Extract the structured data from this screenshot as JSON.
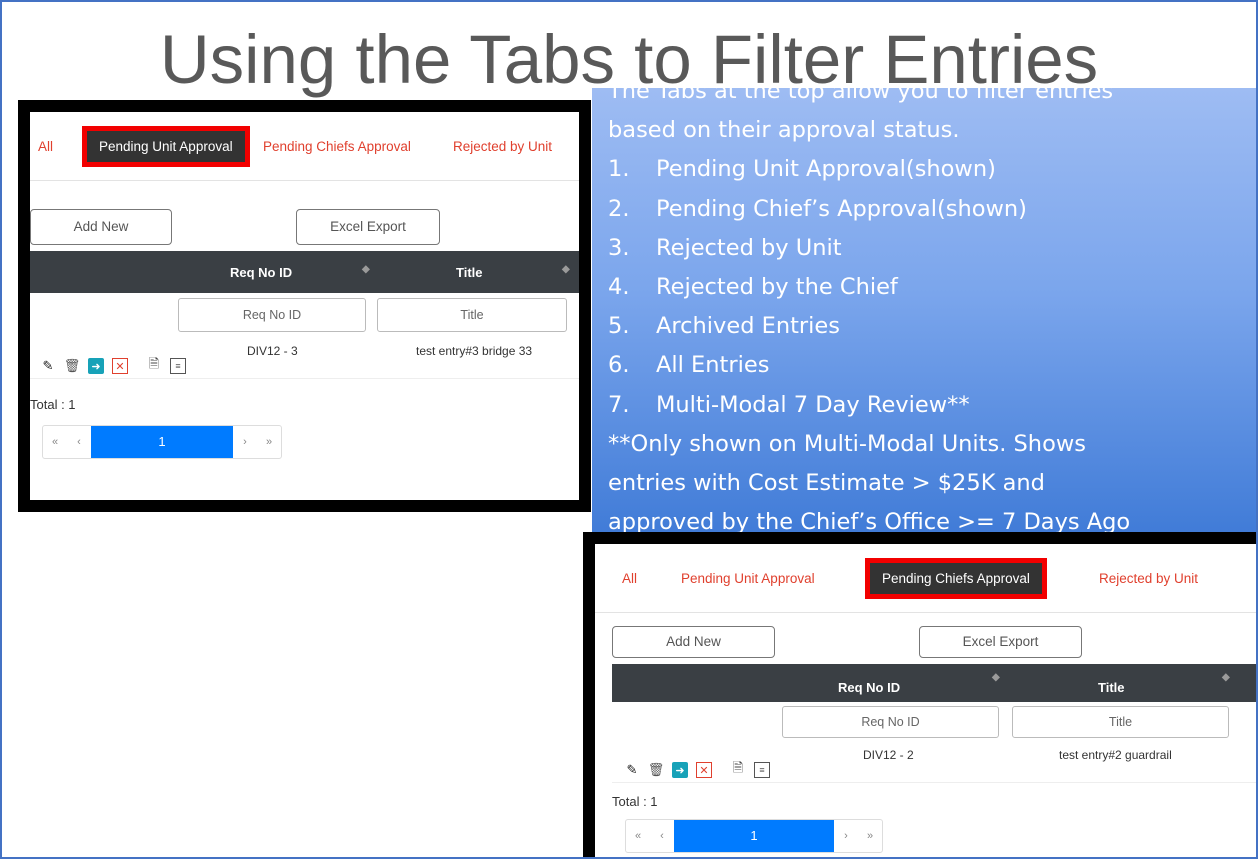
{
  "slide": {
    "title": "Using the Tabs to Filter Entries",
    "intro_hidden": "The Tabs at the top allow you to filter entries",
    "intro": "based on their approval status.",
    "items": [
      {
        "n": "1.",
        "text": "Pending Unit Approval(shown)"
      },
      {
        "n": "2.",
        "text": "Pending Chief’s Approval(shown)"
      },
      {
        "n": "3.",
        "text": "Rejected by Unit"
      },
      {
        "n": "4.",
        "text": "Rejected by the Chief"
      },
      {
        "n": "5.",
        "text": "Archived Entries"
      },
      {
        "n": "6.",
        "text": "All Entries"
      },
      {
        "n": "7.",
        "text": "Multi-Modal 7 Day Review**"
      }
    ],
    "note_lines": [
      "**Only shown on Multi-Modal Units.  Shows",
      "entries with Cost Estimate > $25K and",
      "approved by the Chief’s Office >= 7 Days Ago"
    ]
  },
  "shot1": {
    "tabs": [
      "All",
      "Pending Unit Approval",
      "Pending Chiefs Approval",
      "Rejected by Unit"
    ],
    "active_tab": "Pending Unit Approval",
    "add_new": "Add New",
    "excel_export": "Excel Export",
    "col_req": "Req No ID",
    "col_title": "Title",
    "filter_req_placeholder": "Req No ID",
    "filter_title_placeholder": "Title",
    "row": {
      "req": "DIV12 - 3",
      "title": "test entry#3 bridge 33"
    },
    "total": "Total : 1",
    "pager": {
      "first": "«",
      "prev": "‹",
      "page": "1",
      "next": "›",
      "last": "»"
    }
  },
  "shot2": {
    "tabs": [
      "All",
      "Pending Unit Approval",
      "Pending Chiefs Approval",
      "Rejected by Unit"
    ],
    "active_tab": "Pending Chiefs Approval",
    "add_new": "Add New",
    "excel_export": "Excel Export",
    "col_req": "Req No ID",
    "col_title": "Title",
    "filter_req_placeholder": "Req No ID",
    "filter_title_placeholder": "Title",
    "row": {
      "req": "DIV12 - 2",
      "title": "test entry#2 guardrail"
    },
    "total": "Total : 1",
    "pager": {
      "first": "«",
      "prev": "‹",
      "page": "1",
      "next": "›",
      "last": "»"
    }
  },
  "colors": {
    "accent_red": "#e0402e",
    "highlight": "#f20000",
    "header_dark": "#3a3f44",
    "pager_blue": "#007bff",
    "teal": "#17a2b8"
  }
}
